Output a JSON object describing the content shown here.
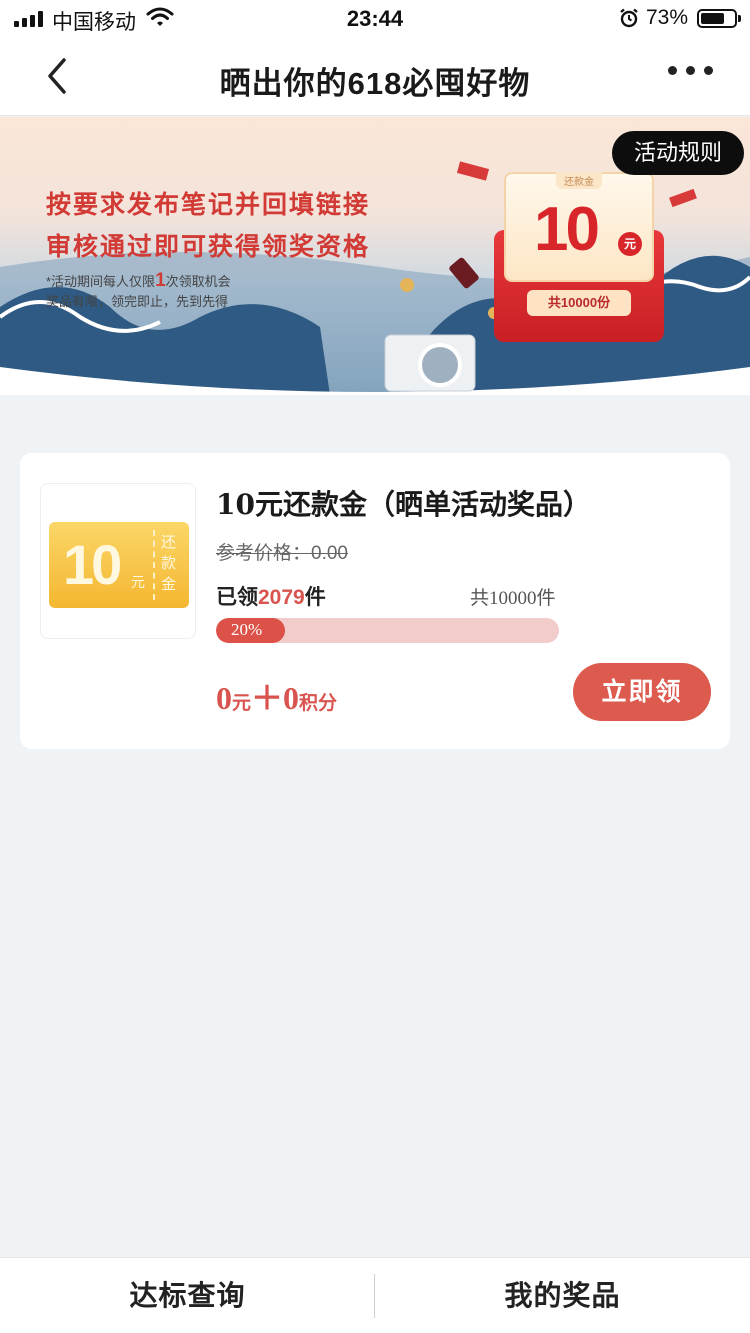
{
  "status_bar": {
    "carrier": "中国移动",
    "time": "23:44",
    "battery_percent": "73%",
    "battery_level": 0.73,
    "icons": [
      "signal-icon",
      "wifi-icon",
      "alarm-icon",
      "battery-icon"
    ]
  },
  "nav": {
    "title": "晒出你的618必囤好物",
    "back_icon": "chevron-left-icon",
    "more_icon": "more-dots-icon"
  },
  "banner": {
    "line1": "按要求发布笔记并回填链接",
    "line2": "审核通过即可获得领奖资格",
    "note1_prefix": "*活动期间每人仅限",
    "note1_count": "1",
    "note1_suffix": "次领取机会",
    "note2": "奖品有限，领完即止，先到先得",
    "rules_button": "活动规则",
    "redpack": {
      "tag": "还款金",
      "amount": "10",
      "unit": "元",
      "total": "共10000份"
    }
  },
  "prize": {
    "thumb": {
      "amount": "10",
      "unit": "元",
      "side_label": "还款金"
    },
    "title": "10元还款金（晒单活动奖品）",
    "reference_price": "参考价格：0.00",
    "claimed_prefix": "已领",
    "claimed_count": "2079",
    "claimed_suffix": "件",
    "total": "共10000件",
    "progress_label": "20%",
    "progress_value": 0.2,
    "price_yuan": "0",
    "price_yuan_unit": "元",
    "price_plus": "＋",
    "price_points": "0",
    "price_points_unit": "积分",
    "claim_button": "立即领"
  },
  "tabs": {
    "left": "达标查询",
    "right": "我的奖品"
  },
  "colors": {
    "accent": "#dc5a4e",
    "banner_text": "#d23a36",
    "progress_track": "#f2cccb"
  }
}
